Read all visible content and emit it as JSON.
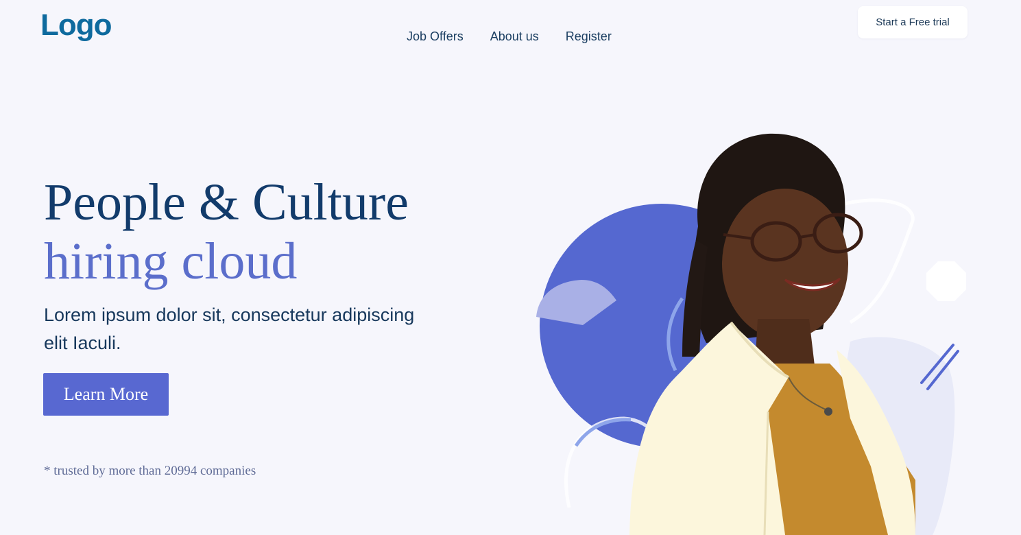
{
  "header": {
    "logo": "Logo",
    "nav": [
      {
        "label": "Job Offers"
      },
      {
        "label": "About us"
      },
      {
        "label": "Register"
      }
    ],
    "cta": "Start a Free trial"
  },
  "hero": {
    "title_line1": "People & Culture",
    "title_line2": "hiring cloud",
    "subtitle": "Lorem ipsum dolor sit, consectetur adipiscing elit Iaculi.",
    "button": "Learn More",
    "trusted": "* trusted by more than 20994 companies"
  },
  "colors": {
    "background": "#f6f6fc",
    "brand_blue": "#0e6a9e",
    "heading": "#123b6b",
    "accent": "#5b6ecb",
    "button": "#5868d1"
  },
  "icons": [
    "decorative-blob",
    "decorative-slash"
  ]
}
